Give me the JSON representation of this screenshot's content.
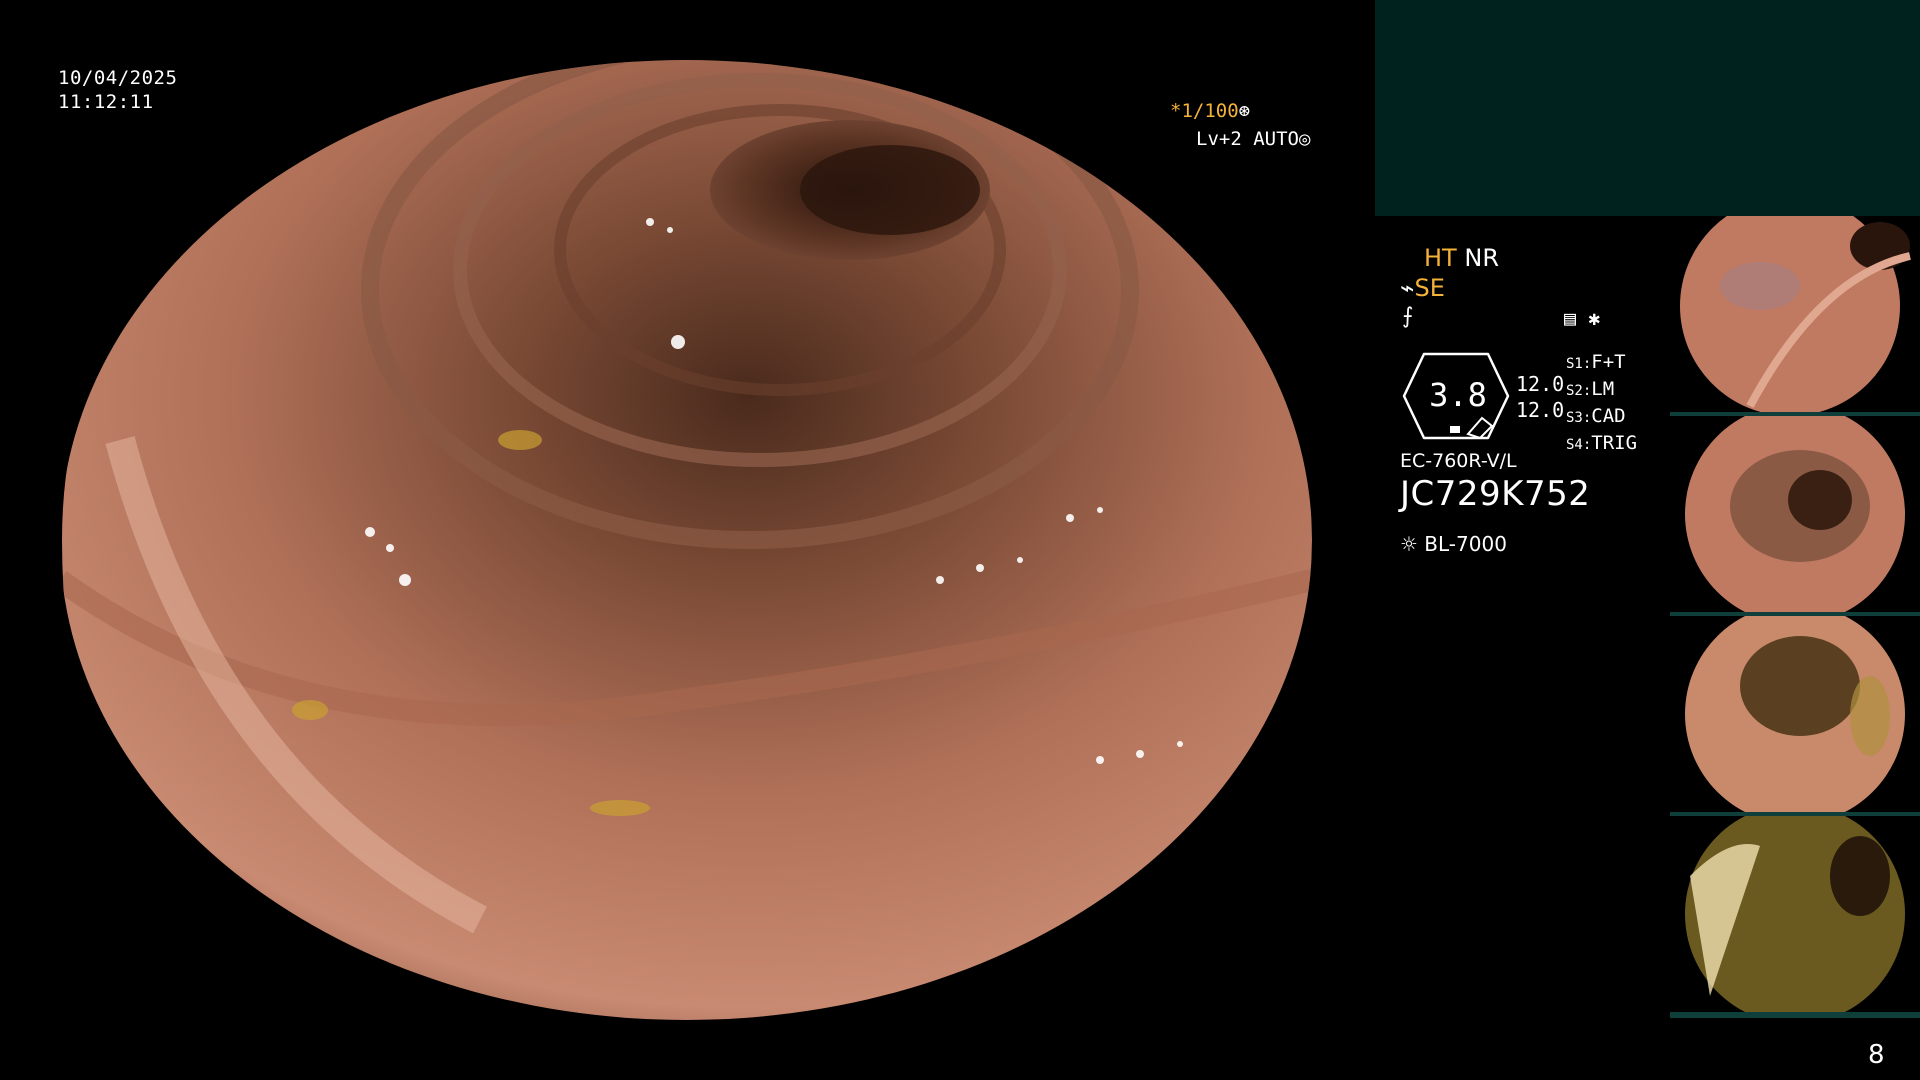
{
  "overlay": {
    "date": "10/04/2025",
    "time": "11:12:11",
    "shutter": "*1/100",
    "level": "Lv+2 AUTO"
  },
  "settings": {
    "ht": "HT",
    "nr": "NR",
    "se": "SE",
    "hex_value": "3.8",
    "val_a": "12.0",
    "val_b": "12.0",
    "slots": [
      {
        "key": "S1:",
        "value": "F+T"
      },
      {
        "key": "S2:",
        "value": "LM"
      },
      {
        "key": "S3:",
        "value": "CAD"
      },
      {
        "key": "S4:",
        "value": "TRIG"
      }
    ],
    "model": "EC-760R-V/L",
    "serial": "JC729K752",
    "lamp": "BL-7000"
  },
  "page_number": "8",
  "colors": {
    "accent": "#f4b23a",
    "panel": "#00221f",
    "thumb_border": "#0f3f3a"
  }
}
